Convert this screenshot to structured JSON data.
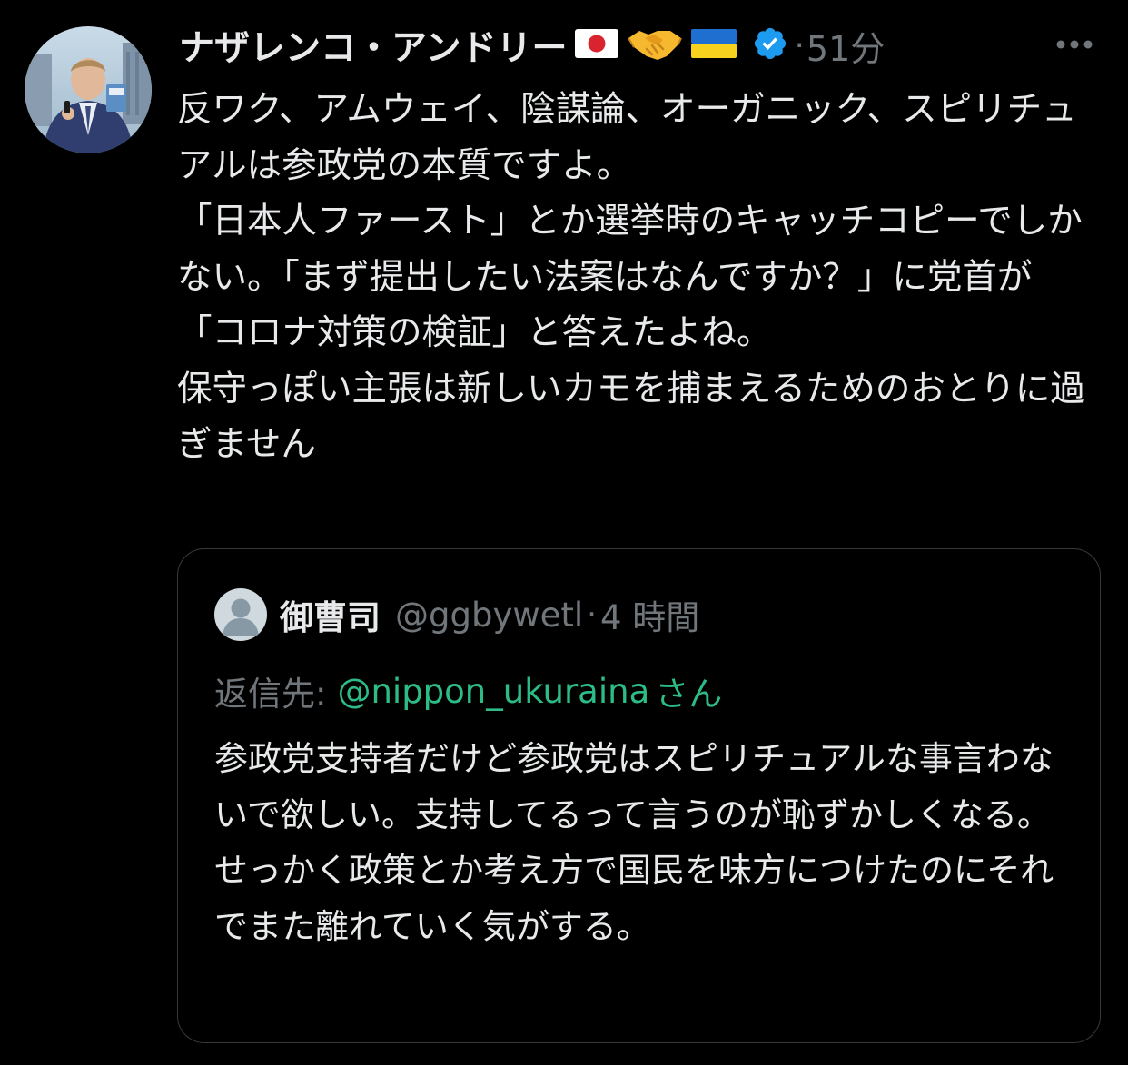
{
  "tweet": {
    "author_name": "ナザレンコ・アンドリー",
    "flags": [
      "flag-japan-icon",
      "handshake-icon",
      "flag-ukraine-icon"
    ],
    "verified": true,
    "time_separator": "·",
    "time": "51分",
    "text": "反ワク、アムウェイ、陰謀論、オーガニック、スピリチュアルは参政党の本質ですよ。\n「日本人ファースト」とか選挙時のキャッチコピーでしかない。「まず提出したい法案はなんですか？」に党首が「コロナ対策の検証」と答えたよね。\n保守っぽい主張は新しいカモを捕まえるためのおとりに過ぎません"
  },
  "quote": {
    "author_name": "御曹司",
    "handle": "@ggbywetl",
    "time_separator": "·",
    "time": "4 時間",
    "reply_label": "返信先:",
    "reply_mention": "@nippon_ukuraina",
    "reply_suffix": "さん",
    "text": "参政党支持者だけど参政党はスピリチュアルな事言わないで欲しい。支持してるって言うのが恥ずかしくなる。\nせっかく政策とか考え方で国民を味方につけたのにそれでまた離れていく気がする。"
  },
  "colors": {
    "background": "#000000",
    "text_primary": "#e7e9ea",
    "text_secondary": "#71767b",
    "verified_blue": "#1d9bf0",
    "mention_green": "#2dbb86",
    "border": "#38393b"
  }
}
